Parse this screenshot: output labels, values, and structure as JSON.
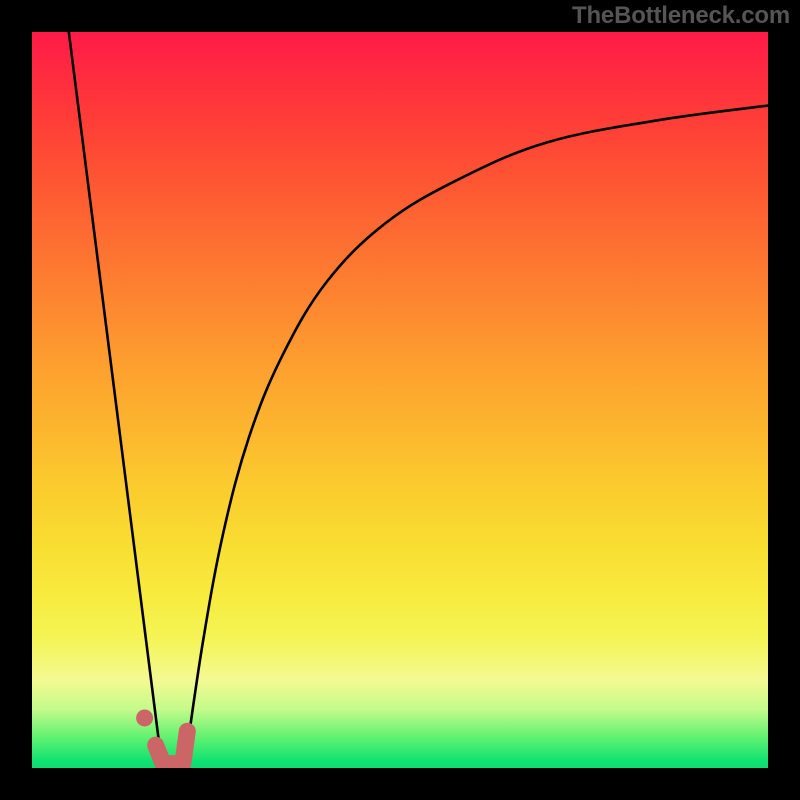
{
  "watermark": "TheBottleneck.com",
  "chart_data": {
    "type": "line",
    "title": "",
    "xlabel": "",
    "ylabel": "",
    "xlim": [
      0,
      100
    ],
    "ylim": [
      0,
      100
    ],
    "grid": false,
    "legend": false,
    "background_gradient": {
      "stops": [
        {
          "pct": 0,
          "color": "#FF1A48"
        },
        {
          "pct": 6,
          "color": "#FF2C3F"
        },
        {
          "pct": 14,
          "color": "#FF4336"
        },
        {
          "pct": 22,
          "color": "#FE5B32"
        },
        {
          "pct": 30,
          "color": "#FD7331"
        },
        {
          "pct": 38,
          "color": "#FD8A30"
        },
        {
          "pct": 46,
          "color": "#FDA12F"
        },
        {
          "pct": 54,
          "color": "#FCB62E"
        },
        {
          "pct": 62,
          "color": "#FBCC2E"
        },
        {
          "pct": 70,
          "color": "#F9DE32"
        },
        {
          "pct": 77,
          "color": "#F7EC3F"
        },
        {
          "pct": 83,
          "color": "#F4F559"
        },
        {
          "pct": 88,
          "color": "#F4FA92"
        },
        {
          "pct": 92,
          "color": "#C5FA8B"
        },
        {
          "pct": 96,
          "color": "#5CF170"
        },
        {
          "pct": 99,
          "color": "#11E271"
        },
        {
          "pct": 100,
          "color": "#0DDC71"
        }
      ]
    },
    "series": [
      {
        "name": "left-descending-line",
        "color": "#000000",
        "points": [
          {
            "x": 5.0,
            "y": 100
          },
          {
            "x": 17.7,
            "y": 0
          }
        ]
      },
      {
        "name": "right-ascending-curve",
        "color": "#000000",
        "points": [
          {
            "x": 20.7,
            "y": 0
          },
          {
            "x": 23.2,
            "y": 17
          },
          {
            "x": 26.0,
            "y": 32
          },
          {
            "x": 29.5,
            "y": 45
          },
          {
            "x": 34.0,
            "y": 56
          },
          {
            "x": 40.0,
            "y": 66
          },
          {
            "x": 48.0,
            "y": 74
          },
          {
            "x": 58.0,
            "y": 80
          },
          {
            "x": 70.0,
            "y": 85
          },
          {
            "x": 85.0,
            "y": 88
          },
          {
            "x": 100.0,
            "y": 90
          }
        ]
      }
    ],
    "marker": {
      "name": "optimum-marker",
      "color": "#CC6666",
      "polyline": [
        {
          "x": 16.8,
          "y": 3.1
        },
        {
          "x": 17.8,
          "y": 0.6
        },
        {
          "x": 20.5,
          "y": 0.6
        },
        {
          "x": 21.1,
          "y": 5.0
        }
      ],
      "dot": {
        "x": 15.3,
        "y": 6.8
      }
    }
  }
}
